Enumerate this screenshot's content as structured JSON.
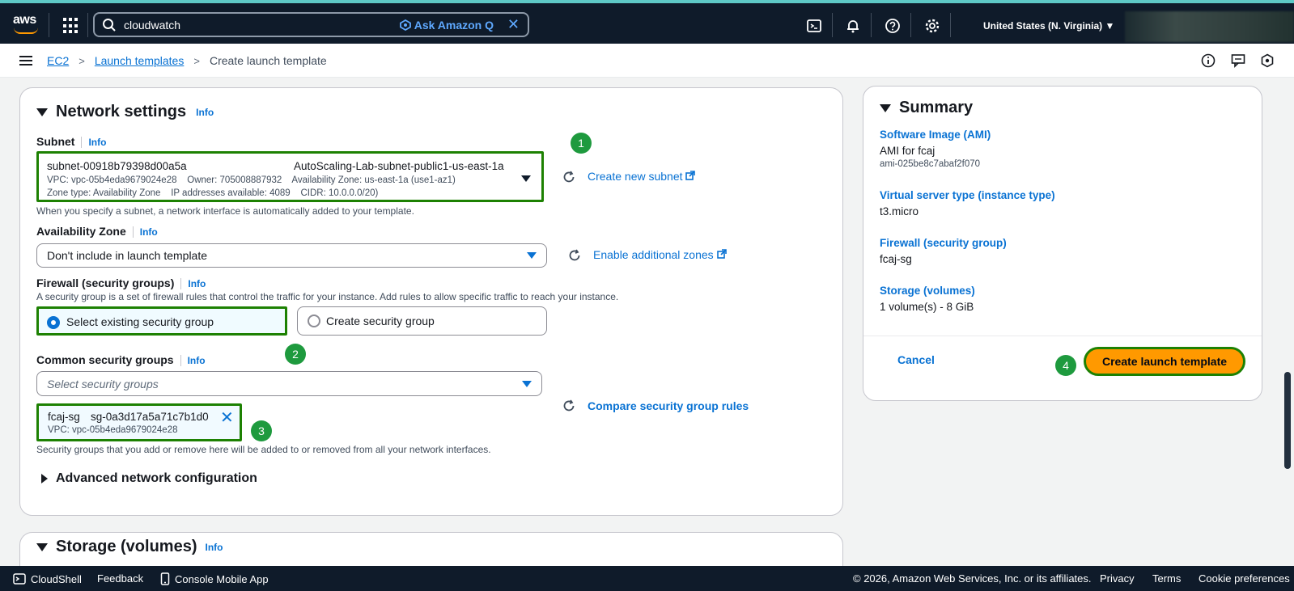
{
  "topbar": {
    "search_value": "cloudwatch",
    "ask_q_label": "Ask Amazon Q",
    "region_label": "United States (N. Virginia)"
  },
  "breadcrumb": {
    "items": [
      "EC2",
      "Launch templates"
    ],
    "current": "Create launch template"
  },
  "network": {
    "title": "Network settings",
    "info": "Info",
    "subnet": {
      "label": "Subnet",
      "id": "subnet-00918b79398d00a5a",
      "name": "AutoScaling-Lab-subnet-public1-us-east-1a",
      "line2": "VPC: vpc-05b4eda9679024e28    Owner: 705008887932    Availability Zone: us-east-1a (use1-az1)",
      "line3": "Zone type: Availability Zone    IP addresses available: 4089    CIDR: 10.0.0.0/20)",
      "hint": "When you specify a subnet, a network interface is automatically added to your template.",
      "create_link": "Create new subnet"
    },
    "az": {
      "label": "Availability Zone",
      "value": "Don't include in launch template",
      "link": "Enable additional zones"
    },
    "firewall": {
      "label": "Firewall (security groups)",
      "hint": "A security group is a set of firewall rules that control the traffic for your instance. Add rules to allow specific traffic to reach your instance.",
      "opt_existing": "Select existing security group",
      "opt_create": "Create security group"
    },
    "common_sg": {
      "label": "Common security groups",
      "placeholder": "Select security groups",
      "token_name": "fcaj-sg",
      "token_id": "sg-0a3d17a5a71c7b1d0",
      "token_vpc": "VPC: vpc-05b4eda9679024e28",
      "compare_link": "Compare security group rules",
      "hint": "Security groups that you add or remove here will be added to or removed from all your network interfaces."
    },
    "advanced": "Advanced network configuration"
  },
  "storage": {
    "title": "Storage (volumes)",
    "info": "Info"
  },
  "summary": {
    "title": "Summary",
    "ami_label": "Software Image (AMI)",
    "ami_value": "AMI for fcaj",
    "ami_id": "ami-025be8c7abaf2f070",
    "type_label": "Virtual server type (instance type)",
    "type_value": "t3.micro",
    "fw_label": "Firewall (security group)",
    "fw_value": "fcaj-sg",
    "storage_label": "Storage (volumes)",
    "storage_value": "1 volume(s) - 8 GiB",
    "cancel": "Cancel",
    "create": "Create launch template"
  },
  "badges": [
    "1",
    "2",
    "3",
    "4"
  ],
  "footer": {
    "cloudshell": "CloudShell",
    "feedback": "Feedback",
    "mobile": "Console Mobile App",
    "copyright": "© 2026, Amazon Web Services, Inc. or its affiliates.",
    "privacy": "Privacy",
    "terms": "Terms",
    "cookies": "Cookie preferences"
  },
  "colors": {
    "accent": "#0972d3",
    "primary_button": "#ff9900",
    "highlight": "#1d8102",
    "badge": "#1e9a3e"
  }
}
